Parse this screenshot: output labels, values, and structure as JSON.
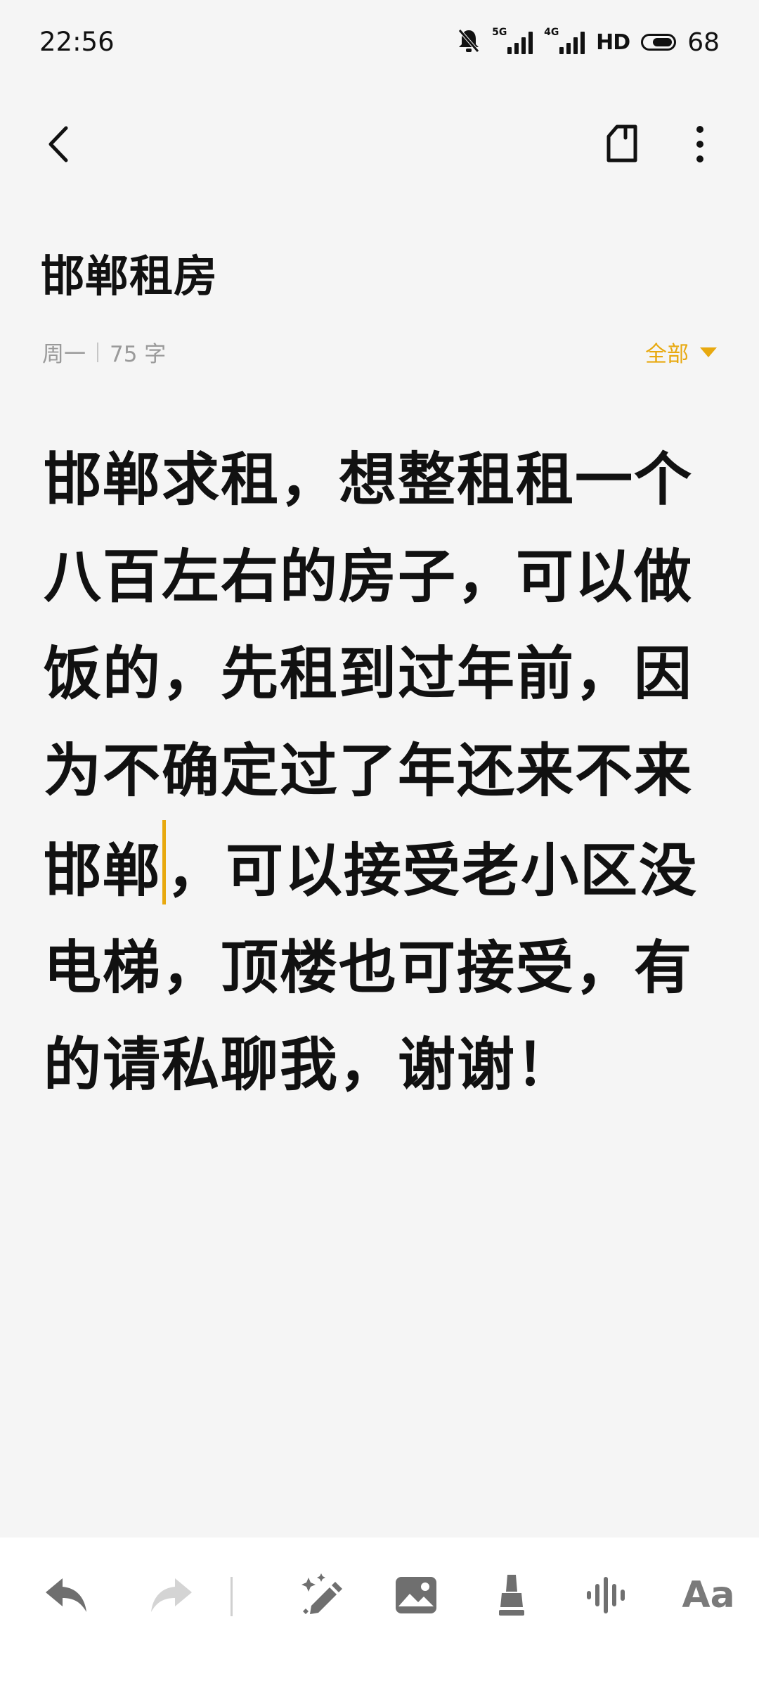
{
  "status_bar": {
    "time": "22:56",
    "signal1_tag": "5G",
    "signal2_tag": "4G",
    "hd_label": "HD",
    "battery_level": "68"
  },
  "note": {
    "title": "邯郸租房",
    "day": "周一",
    "word_count": "75 字",
    "folder": "全部",
    "content_before_cursor": "邯郸求租，想整租租一个八百左右的房子，可以做饭的，先租到过年前，因为不确定过了年还来不来邯郸",
    "content_after_cursor": "，可以接受老小区没电梯，顶楼也可接受，有的请私聊我，谢谢！"
  },
  "bottom_toolbar": {
    "font_button_label": "Aa"
  },
  "colors": {
    "accent": "#e8a90f",
    "background": "#f5f5f5",
    "icon_gray": "#7a7a7a",
    "icon_disabled": "#cfcfcf"
  }
}
